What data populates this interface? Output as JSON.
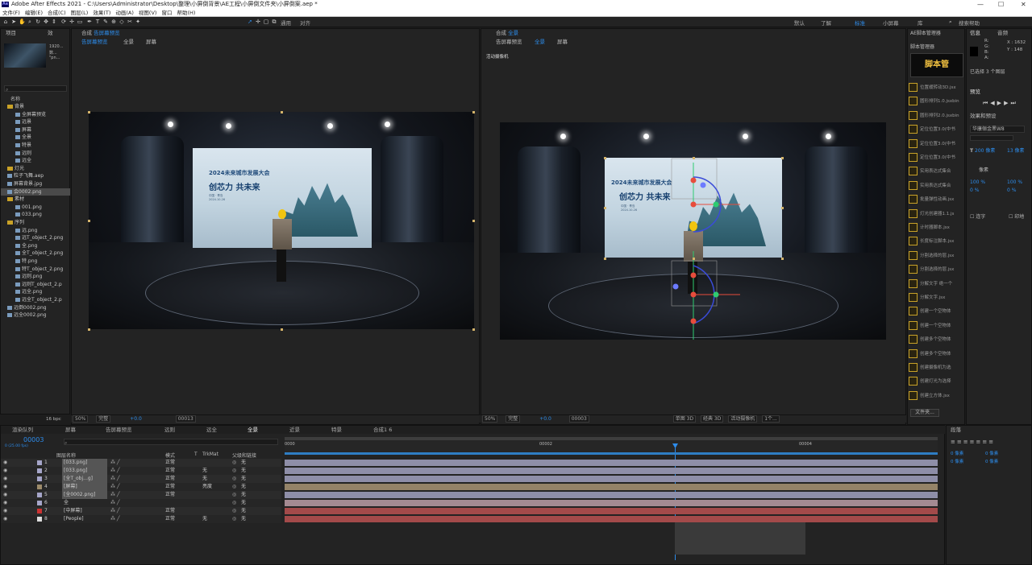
{
  "titlebar": {
    "title": "Adobe After Effects 2021 - C:\\Users\\Administrator\\Desktop\\整理\\小屏倒背景\\AE工程\\小屏倒文件夹\\小屏倒案.aep *",
    "app_badge": "Ae"
  },
  "menu": [
    "文件(F)",
    "编辑(E)",
    "合成(C)",
    "图层(L)",
    "效果(T)",
    "动画(A)",
    "视图(V)",
    "窗口",
    "帮助(H)"
  ],
  "toolbar": {
    "snap_label": "通用",
    "align_label": "对齐",
    "workspaces": [
      "默认",
      "了解",
      "标准",
      "小屏幕",
      "库"
    ],
    "active_workspace": "标准",
    "search_placeholder": "搜索帮助"
  },
  "project": {
    "tab": "项目",
    "tab2": "效",
    "thumb_info1": "1920...",
    "thumb_info2": "\"pn...",
    "thumb_info3": "数...",
    "col_name": "名称",
    "items": [
      {
        "name": "背景",
        "type": "folder",
        "indent": 0
      },
      {
        "name": "全屏幕预览",
        "type": "comp",
        "indent": 1
      },
      {
        "name": "远景",
        "type": "comp",
        "indent": 1
      },
      {
        "name": "屏幕",
        "type": "comp",
        "indent": 1
      },
      {
        "name": "全景",
        "type": "comp",
        "indent": 1
      },
      {
        "name": "特景",
        "type": "comp",
        "indent": 1
      },
      {
        "name": "远则",
        "type": "comp",
        "indent": 1
      },
      {
        "name": "远全",
        "type": "comp",
        "indent": 1
      },
      {
        "name": "灯光",
        "type": "folder",
        "indent": 0
      },
      {
        "name": "粒子飞舞.aep",
        "type": "file",
        "indent": 0
      },
      {
        "name": "屏幕背景.jpg",
        "type": "file",
        "indent": 0
      },
      {
        "name": "会0002.png",
        "type": "file",
        "indent": 0,
        "selected": true
      },
      {
        "name": "素材",
        "type": "folder",
        "indent": 0
      },
      {
        "name": "001.png",
        "type": "file",
        "indent": 1
      },
      {
        "name": "033.png",
        "type": "file",
        "indent": 1
      },
      {
        "name": "序列",
        "type": "folder",
        "indent": 0
      },
      {
        "name": "远.png",
        "type": "file",
        "indent": 1
      },
      {
        "name": "远T_object_2.png",
        "type": "file",
        "indent": 1
      },
      {
        "name": "全.png",
        "type": "file",
        "indent": 1
      },
      {
        "name": "全T_object_2.png",
        "type": "file",
        "indent": 1
      },
      {
        "name": "特.png",
        "type": "file",
        "indent": 1
      },
      {
        "name": "特T_object_2.png",
        "type": "file",
        "indent": 1
      },
      {
        "name": "远则.png",
        "type": "file",
        "indent": 1
      },
      {
        "name": "远则T_object_2.p",
        "type": "file",
        "indent": 1
      },
      {
        "name": "远全.png",
        "type": "file",
        "indent": 1
      },
      {
        "name": "远全T_object_2.p",
        "type": "file",
        "indent": 1
      },
      {
        "name": "远倒0002.png",
        "type": "file",
        "indent": 0
      },
      {
        "name": "远全0002.png",
        "type": "file",
        "indent": 0
      }
    ],
    "bpc": "16 bpc"
  },
  "viewer_left": {
    "header": "合成",
    "comp_name": "告屏幕预览",
    "breadcrumbs": [
      "告屏幕预览",
      "全景",
      "屏幕"
    ],
    "zoom": "50%",
    "quality": "完整",
    "timecode": "00013",
    "exposure": "+0.0"
  },
  "viewer_right": {
    "header": "合成",
    "comp_name": "全景",
    "breadcrumbs": [
      "告屏幕预览",
      "全景",
      "屏幕"
    ],
    "camera_label": "活动摄像机",
    "zoom": "50%",
    "quality": "完整",
    "timecode": "00003",
    "exposure": "+0.0",
    "view_mode": "单图 3D",
    "renderer": "经典 3D",
    "cam_select": "活动摄像机",
    "views": "1个..."
  },
  "screen": {
    "headline": "2024未来城市发展大会",
    "slogan": "创芯力  共未来",
    "sub1": "中国 · 青岛",
    "sub2": "2024.10.26"
  },
  "scripts": {
    "tab": "AE脚本管理器",
    "sub": "脚本管理器",
    "logo_text": "脚本管",
    "btn_file": "文件夹...",
    "items": [
      "位置缓转动3D.jsx",
      "圆形排列1.0.jsxbin",
      "圆形排列2.0.jsxbin",
      "定位位置3.0(中书",
      "定位位置3.0(中书",
      "定位位置3.0(中书",
      "实用表达式集合",
      "实用表达式集合",
      "批量弹性动画.jsx",
      "灯光创建器1.1.js",
      "计时器脚本.jsx",
      "长度标注脚本.jsx",
      "分割选择的层.jsx",
      "分割选择的层.jsx",
      "分解文字 绝一个",
      "分解文字.jsx",
      "创建一个空物体",
      "创建一个空物体",
      "创建多个空物体",
      "创建多个空物体",
      "创建摄像机为选",
      "创建灯光为选择",
      "创建立方体.jsx"
    ]
  },
  "info": {
    "tab": "信息",
    "tab2": "音频",
    "r": "R:",
    "g": "G:",
    "b": "B:",
    "a": "A:",
    "x": "X : 1632",
    "y": "Y : 148",
    "selected": "已选择 3 个图层",
    "preview": "预览",
    "effects": "效果和预设",
    "font": "华康俪金黑W8",
    "font_size": "200 像素",
    "leading": "13 像素",
    "unit": "像素",
    "scale": "100 %",
    "percent2": "100 %",
    "tracking": "0 %",
    "tracking2": "0 %",
    "ligature": "连字",
    "hindi": "印地"
  },
  "timeline": {
    "tabs": [
      "渲染队列",
      "屏幕",
      "告屏幕预览",
      "远则",
      "远全",
      "全景",
      "近景",
      "特景",
      "合成1 6"
    ],
    "active_tab": "全景",
    "timecode": "00003",
    "fps": "0 (25.00 fps)",
    "cols": [
      "图层名称",
      "模式",
      "T",
      "TrkMat",
      "父级和链接"
    ],
    "ruler": [
      "0000",
      "00002",
      "00004"
    ],
    "layers": [
      {
        "num": "1",
        "name": "[033.png]",
        "mode": "正常",
        "trk": "",
        "parent": "无",
        "color": "#a6a6c9",
        "bar": "#8e8ea8"
      },
      {
        "num": "2",
        "name": "[033.png]",
        "mode": "正常",
        "trk": "无",
        "parent": "无",
        "color": "#a6a6c9",
        "bar": "#8e8ea8"
      },
      {
        "num": "3",
        "name": "[全T_obj...g]",
        "mode": "正常",
        "trk": "无",
        "parent": "无",
        "color": "#a6a6c9",
        "bar": "#8e8ea8"
      },
      {
        "num": "4",
        "name": "[屏幕]",
        "mode": "正常",
        "trk": "亮度",
        "parent": "无",
        "color": "#9d8b6a",
        "bar": "#948368"
      },
      {
        "num": "5",
        "name": "[全0002.png]",
        "mode": "正常",
        "trk": "",
        "parent": "无",
        "color": "#a6a6c9",
        "bar": "#8e8ea8"
      },
      {
        "num": "6",
        "name": "全",
        "mode": "",
        "trk": "",
        "parent": "无",
        "color": "#a6a6c9",
        "bar": "#a48a92"
      },
      {
        "num": "7",
        "name": "[中屏幕]",
        "mode": "正常",
        "trk": "",
        "parent": "无",
        "color": "#c33",
        "bar": "#a34a4a"
      },
      {
        "num": "8",
        "name": "[People]",
        "mode": "正常",
        "trk": "无",
        "parent": "无",
        "color": "#ddd",
        "bar": "#a34a4a"
      }
    ]
  },
  "align": {
    "tab": "段落",
    "v1": "0 像素",
    "v2": "0 像素",
    "v3": "0 像素",
    "v4": "0 像素"
  }
}
